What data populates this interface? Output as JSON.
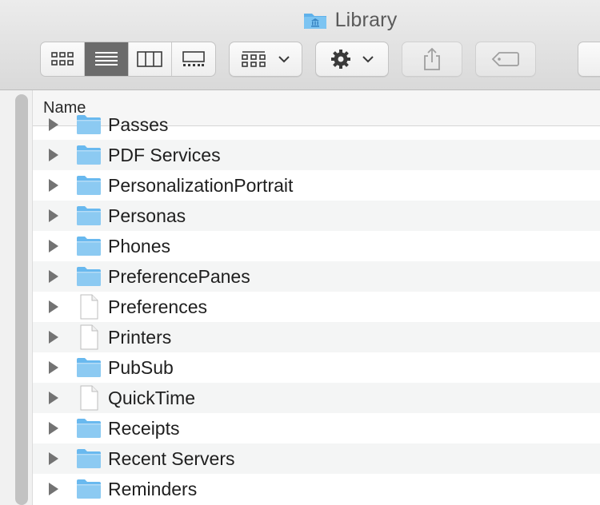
{
  "window": {
    "title": "Library",
    "title_icon": "library-folder-icon"
  },
  "toolbar": {
    "view_buttons": [
      {
        "icon": "icon-view-icon",
        "active": false
      },
      {
        "icon": "list-view-icon",
        "active": true
      },
      {
        "icon": "column-view-icon",
        "active": false
      },
      {
        "icon": "gallery-view-icon",
        "active": false
      }
    ],
    "group_button": {
      "icon": "group-by-icon",
      "dropdown": "chevron-down-icon"
    },
    "action_button": {
      "icon": "gear-icon",
      "dropdown": "chevron-down-icon"
    },
    "share_button": {
      "icon": "share-icon"
    },
    "tag_button": {
      "icon": "tag-icon"
    }
  },
  "list": {
    "column_header": "Name",
    "rows": [
      {
        "name": "Passes",
        "kind": "folder"
      },
      {
        "name": "PDF Services",
        "kind": "folder"
      },
      {
        "name": "PersonalizationPortrait",
        "kind": "folder"
      },
      {
        "name": "Personas",
        "kind": "folder"
      },
      {
        "name": "Phones",
        "kind": "folder"
      },
      {
        "name": "PreferencePanes",
        "kind": "folder"
      },
      {
        "name": "Preferences",
        "kind": "document"
      },
      {
        "name": "Printers",
        "kind": "document"
      },
      {
        "name": "PubSub",
        "kind": "folder"
      },
      {
        "name": "QuickTime",
        "kind": "document"
      },
      {
        "name": "Receipts",
        "kind": "folder"
      },
      {
        "name": "Recent Servers",
        "kind": "folder"
      },
      {
        "name": "Reminders",
        "kind": "folder"
      }
    ]
  },
  "colors": {
    "folder": "#69b9ef",
    "folder_tab": "#8ccaf2",
    "row_alt": "#f4f5f5",
    "selected_segment": "#6b6b6b"
  }
}
